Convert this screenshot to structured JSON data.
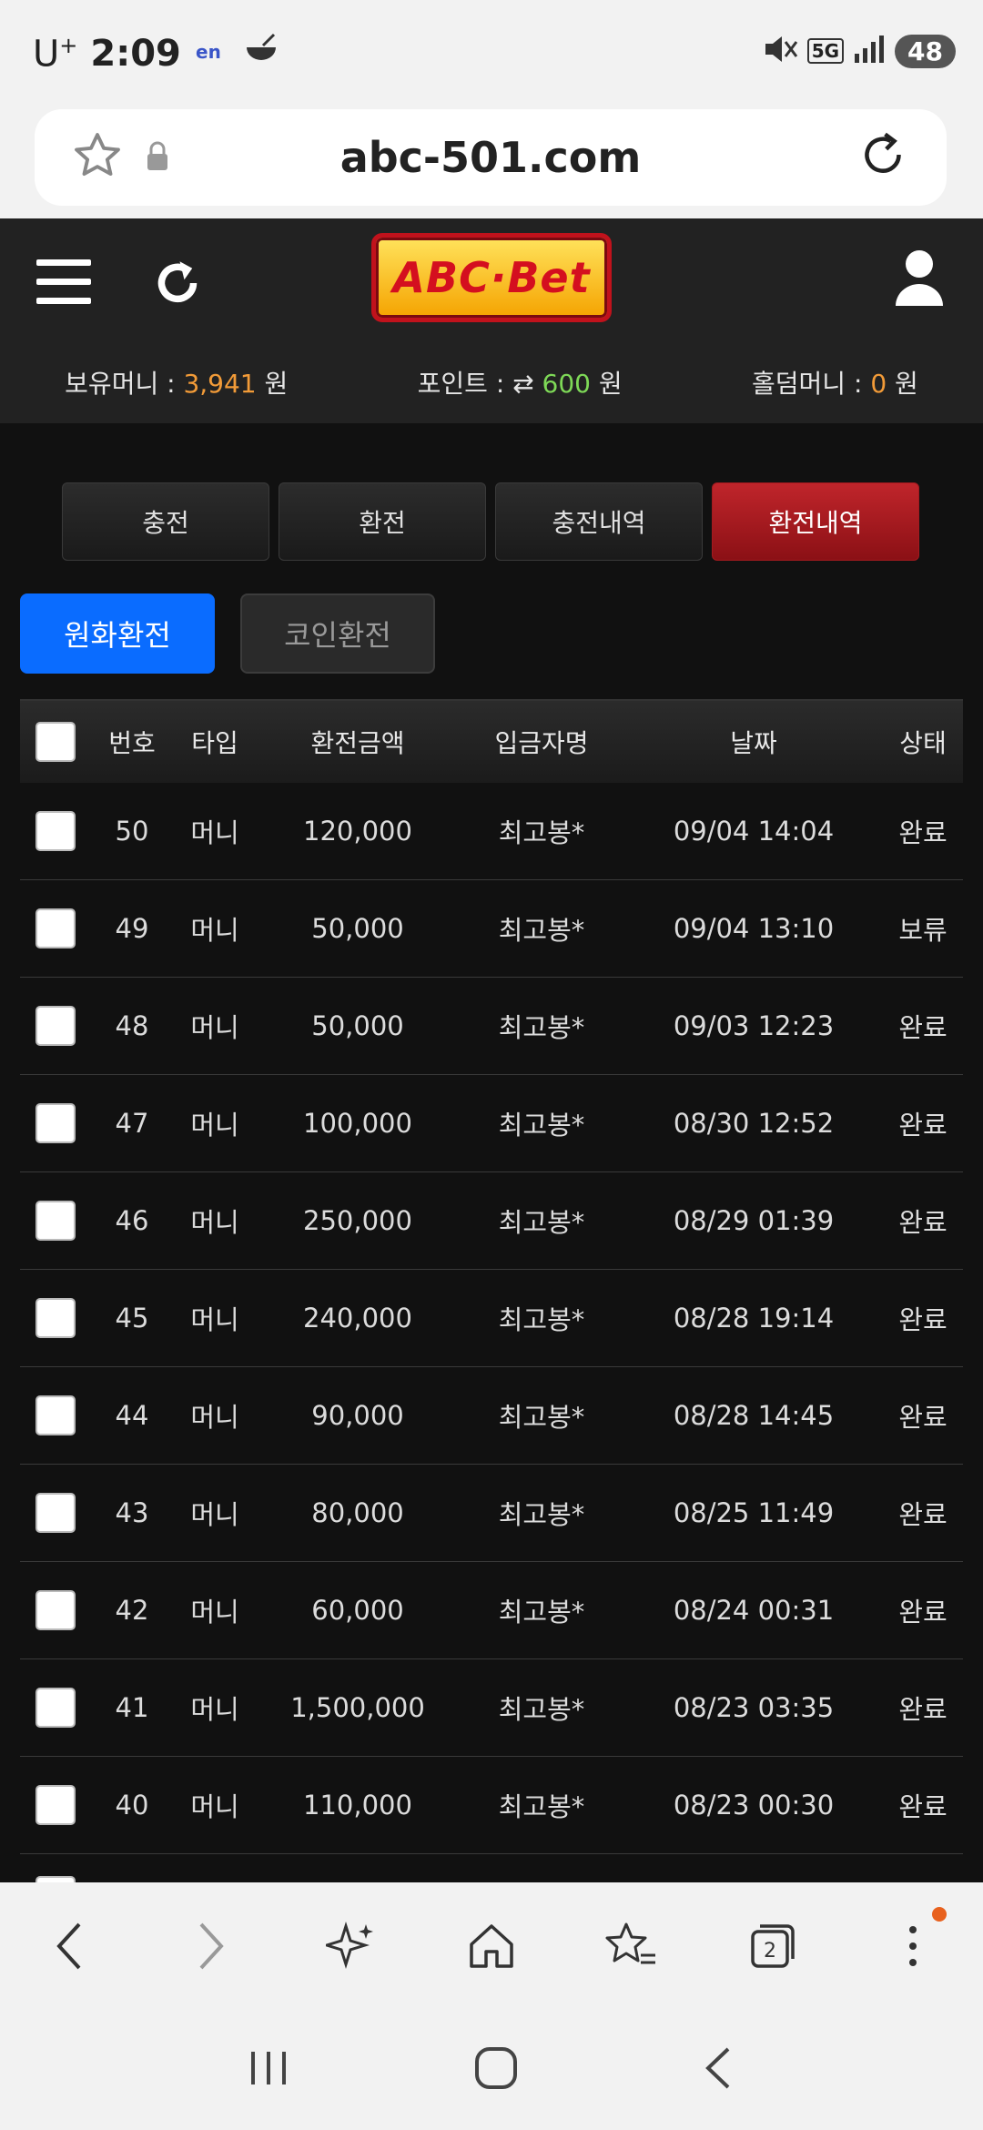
{
  "status_bar": {
    "carrier": "U",
    "carrier_sup": "+",
    "time": "2:09",
    "network": "5G",
    "battery": "48"
  },
  "browser": {
    "url": "abc-501.com"
  },
  "header": {
    "logo_text": "ABC·Bet",
    "balances": {
      "money_label": "보유머니 : ",
      "money_value": "3,941",
      "money_unit": " 원",
      "point_label": "포인트 : ",
      "point_value": "600",
      "point_unit": " 원",
      "holdem_label": "홀덤머니 : ",
      "holdem_value": "0",
      "holdem_unit": " 원"
    }
  },
  "tabs": [
    "충전",
    "환전",
    "충전내역",
    "환전내역"
  ],
  "active_tab": "환전내역",
  "subtabs": [
    "원화환전",
    "코인환전"
  ],
  "table": {
    "headers": [
      "번호",
      "타입",
      "환전금액",
      "입금자명",
      "날짜",
      "상태"
    ],
    "rows": [
      {
        "no": "50",
        "type": "머니",
        "amount": "120,000",
        "name": "최고봉*",
        "date": "09/04 14:04",
        "status": "완료"
      },
      {
        "no": "49",
        "type": "머니",
        "amount": "50,000",
        "name": "최고봉*",
        "date": "09/04 13:10",
        "status": "보류"
      },
      {
        "no": "48",
        "type": "머니",
        "amount": "50,000",
        "name": "최고봉*",
        "date": "09/03 12:23",
        "status": "완료"
      },
      {
        "no": "47",
        "type": "머니",
        "amount": "100,000",
        "name": "최고봉*",
        "date": "08/30 12:52",
        "status": "완료"
      },
      {
        "no": "46",
        "type": "머니",
        "amount": "250,000",
        "name": "최고봉*",
        "date": "08/29 01:39",
        "status": "완료"
      },
      {
        "no": "45",
        "type": "머니",
        "amount": "240,000",
        "name": "최고봉*",
        "date": "08/28 19:14",
        "status": "완료"
      },
      {
        "no": "44",
        "type": "머니",
        "amount": "90,000",
        "name": "최고봉*",
        "date": "08/28 14:45",
        "status": "완료"
      },
      {
        "no": "43",
        "type": "머니",
        "amount": "80,000",
        "name": "최고봉*",
        "date": "08/25 11:49",
        "status": "완료"
      },
      {
        "no": "42",
        "type": "머니",
        "amount": "60,000",
        "name": "최고봉*",
        "date": "08/24 00:31",
        "status": "완료"
      },
      {
        "no": "41",
        "type": "머니",
        "amount": "1,500,000",
        "name": "최고봉*",
        "date": "08/23 03:35",
        "status": "완료"
      },
      {
        "no": "40",
        "type": "머니",
        "amount": "110,000",
        "name": "최고봉*",
        "date": "08/23 00:30",
        "status": "완료"
      }
    ]
  },
  "bottom_nav": {
    "tab_count": "2",
    "icons": [
      "back-icon",
      "forward-icon",
      "sparkle-icon",
      "home-icon",
      "bookmarks-icon",
      "tabs-icon",
      "more-icon"
    ]
  },
  "colors": {
    "accent_red": "#a31a1f",
    "accent_blue": "#0a6cff",
    "money_orange": "#f29b38",
    "point_green": "#7ed957"
  }
}
